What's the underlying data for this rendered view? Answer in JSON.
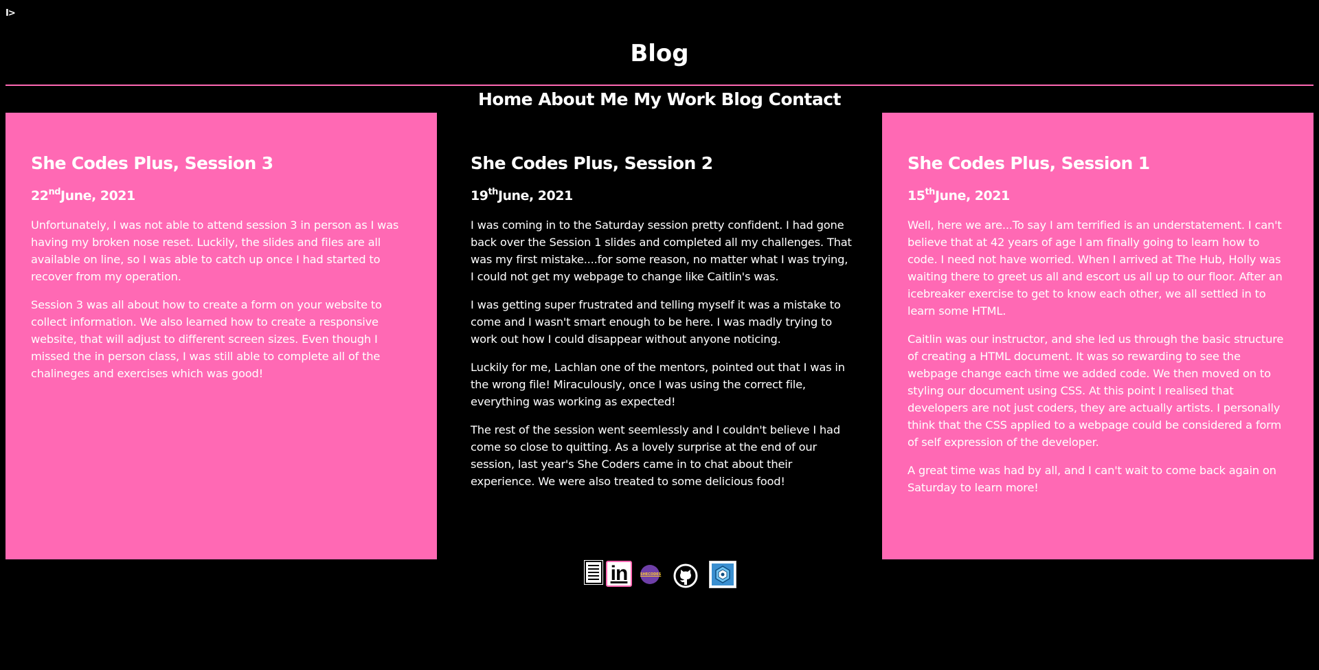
{
  "logo": {
    "text": "I>"
  },
  "page": {
    "title": "Blog"
  },
  "nav": {
    "home": "Home",
    "about": "About Me",
    "work": "My Work",
    "blog": "Blog",
    "contact": "Contact"
  },
  "posts": [
    {
      "title": "She Codes Plus, Session 3",
      "date_day": "22",
      "date_suffix": "nd",
      "date_rest": "June, 2021",
      "paragraphs": [
        "Unfortunately, I was not able to attend session 3 in person as I was having my broken nose reset. Luckily, the slides and files are all available on line, so I was able to catch up once I had started to recover from my operation.",
        "Session 3 was all about how to create a form on your website to collect information. We also learned how to create a responsive website, that will adjust to different screen sizes. Even though I missed the in person class, I was still able to complete all of the chalineges and exercises which was good!"
      ]
    },
    {
      "title": "She Codes Plus, Session 2",
      "date_day": "19",
      "date_suffix": "th",
      "date_rest": "June, 2021",
      "paragraphs": [
        "I was coming in to the Saturday session pretty confident. I had gone back over the Session 1 slides and completed all my challenges. That was my first mistake....for some reason, no matter what I was trying, I could not get my webpage to change like Caitlin's was.",
        "I was getting super frustrated and telling myself it was a mistake to come and I wasn't smart enough to be here. I was madly trying to work out how I could disappear without anyone noticing.",
        "Luckily for me, Lachlan one of the mentors, pointed out that I was in the wrong file! Miraculously, once I was using the correct file, everything was working as expected!",
        "The rest of the session went seemlessly and I couldn't believe I had come so close to quitting. As a lovely surprise at the end of our session, last year's She Coders came in to chat about their experience. We were also treated to some delicious food!"
      ]
    },
    {
      "title": "She Codes Plus, Session 1",
      "date_day": "15",
      "date_suffix": "th",
      "date_rest": "June, 2021",
      "paragraphs": [
        "Well, here we are...To say I am terrified is an understatement. I can't believe that at 42 years of age I am finally going to learn how to code. I need not have worried. When I arrived at The Hub, Holly was waiting there to greet us all and escort us all up to our floor. After an icebreaker exercise to get to know each other, we all settled in to learn some HTML.",
        "Caitlin was our instructor, and she led us through the basic structure of creating a HTML document. It was so rewarding to see the webpage change each time we added code. We then moved on to styling our document using CSS. At this point I realised that developers are not just coders, they are actually artists. I personally think that the CSS applied to a webpage could be considered a form of self expression of the developer.",
        "A great time was had by all, and I can't wait to come back again on Saturday to learn more!"
      ]
    }
  ],
  "social": {
    "linkedin_text": "in",
    "shecodes_text": "SHECODES",
    "icons": [
      "cv-icon",
      "linkedin-icon",
      "shecodes-icon",
      "github-icon",
      "project-icon"
    ]
  },
  "colors": {
    "accent_pink": "#ff69b4",
    "background": "#000000",
    "text": "#ffffff"
  }
}
